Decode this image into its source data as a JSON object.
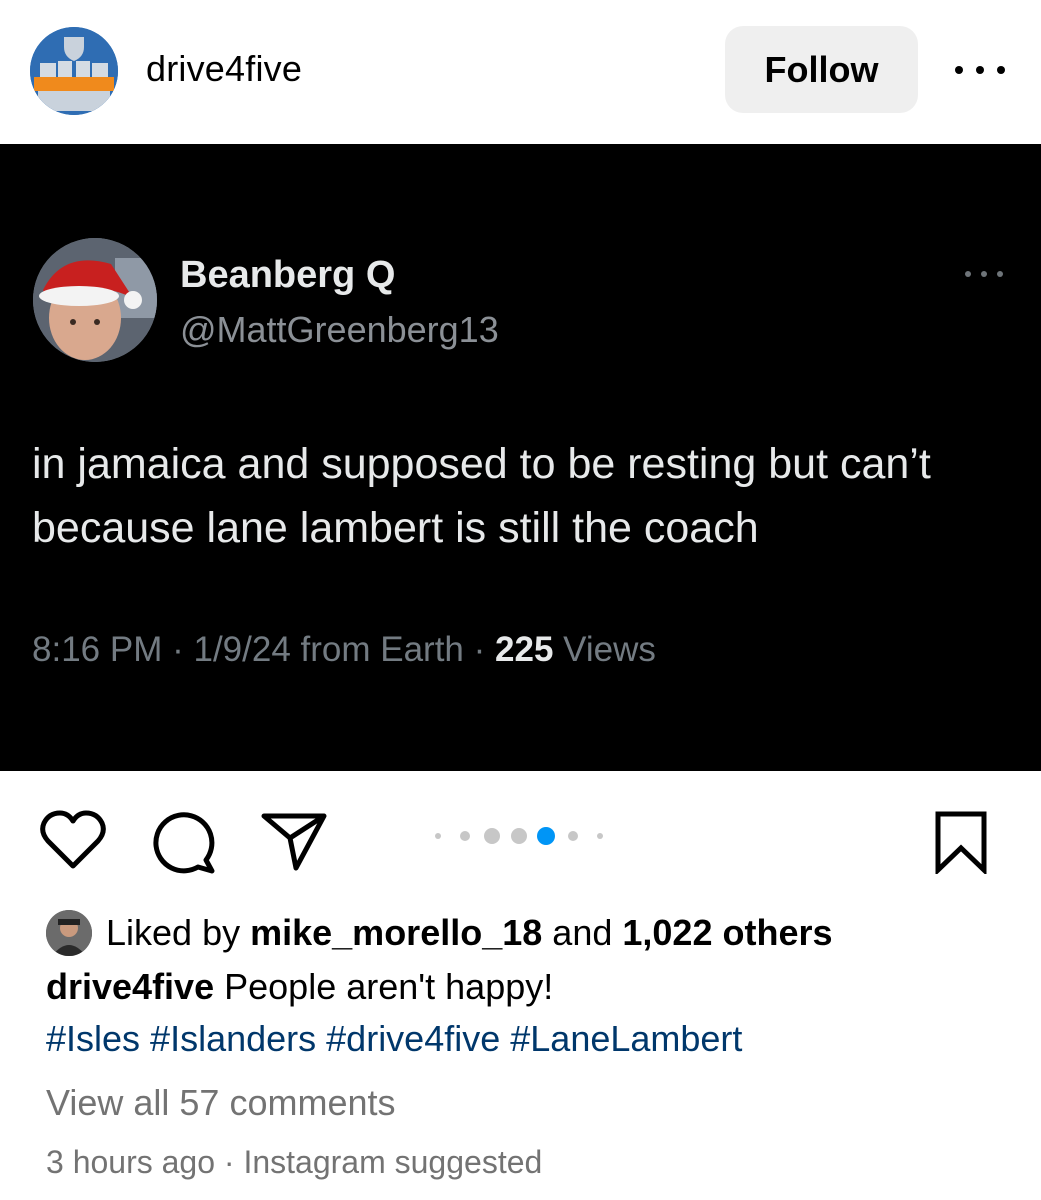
{
  "post": {
    "username": "drive4five",
    "follow_label": "Follow",
    "avatar_text": "DRIVE4FIVE"
  },
  "tweet": {
    "display_name": "Beanberg Q",
    "handle": "@MattGreenberg13",
    "text": "in jamaica and supposed to be resting but can’t because lane lambert is still the coach",
    "time": "8:16 PM",
    "date_source": "1/9/24 from Earth",
    "views_count": "225",
    "views_label": "Views"
  },
  "carousel": {
    "count": 7,
    "active_index": 4
  },
  "likes": {
    "prefix": "Liked by",
    "user": "mike_morello_18",
    "connector": "and",
    "others": "1,022 others"
  },
  "caption": {
    "username": "drive4five",
    "text": "People aren't happy!",
    "hashtags": [
      "#Isles",
      "#Islanders",
      "#drive4five",
      "#LaneLambert"
    ]
  },
  "comments": {
    "view_all": "View all 57 comments"
  },
  "meta": {
    "time_ago": "3 hours ago",
    "separator": "·",
    "suggested": "Instagram suggested"
  },
  "colors": {
    "hashtag": "#00376b",
    "active_dot": "#0095f6",
    "follow_bg": "#efefef"
  }
}
